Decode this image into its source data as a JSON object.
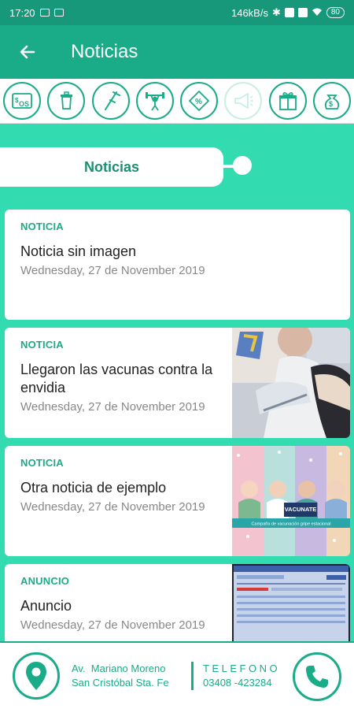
{
  "status_bar": {
    "time": "17:20",
    "network_speed": "146kB/s",
    "battery": "80"
  },
  "app_bar": {
    "back_icon": "arrow-left-icon",
    "title": "Noticias"
  },
  "categories": [
    {
      "icon": "insurance-card-icon",
      "active": true
    },
    {
      "icon": "trash-bin-icon",
      "active": true
    },
    {
      "icon": "crutch-icon",
      "active": true
    },
    {
      "icon": "weightlifter-icon",
      "active": true
    },
    {
      "icon": "discount-tag-icon",
      "active": true
    },
    {
      "icon": "megaphone-icon",
      "active": false
    },
    {
      "icon": "gift-icon",
      "active": true
    },
    {
      "icon": "money-bag-icon",
      "active": true
    }
  ],
  "section": {
    "label": "Noticias"
  },
  "feed": [
    {
      "type": "NOTICIA",
      "title": "Noticia sin imagen",
      "date": "Wednesday, 27 de November 2019",
      "image": "none"
    },
    {
      "type": "NOTICIA",
      "title": "Llegaron las vacunas contra la envidia",
      "date": "Wednesday, 27 de November 2019",
      "image": "vaccination-photo"
    },
    {
      "type": "NOTICIA",
      "title": "Otra noticia de ejemplo",
      "date": "Wednesday, 27 de November 2019",
      "image": "vaccination-campaign-poster"
    },
    {
      "type": "ANUNCIO",
      "title": "Anuncio",
      "date": "Wednesday, 27 de November 2019",
      "image": "screen-photo"
    }
  ],
  "poster": {
    "badge": "VACUNATE",
    "subtitle": "Campaña de vacunación gripe estacional"
  },
  "footer": {
    "address_line1": "Av.  Mariano Moreno",
    "address_line2": "San Cristóbal Sta. Fe",
    "phone_label": "TELEFONO",
    "phone_number": "03408 -423284",
    "pin_icon": "location-pin-icon",
    "phone_icon": "phone-icon"
  },
  "colors": {
    "primary": "#1aab88",
    "dark": "#17987b",
    "background": "#33dcb0"
  }
}
